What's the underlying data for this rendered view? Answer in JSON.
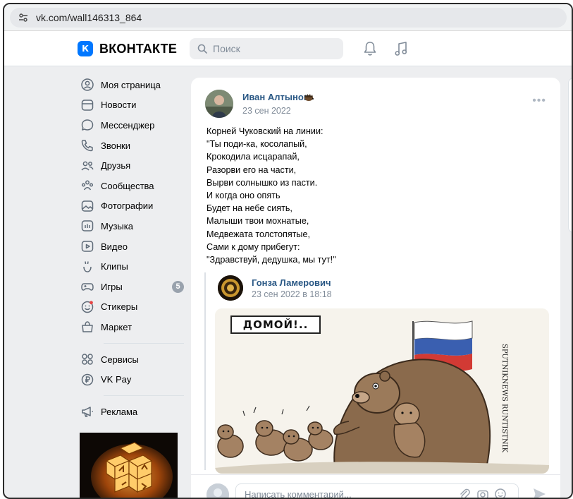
{
  "browser": {
    "url": "vk.com/wall146313_864"
  },
  "header": {
    "logo_text": "ВКОНТАКТЕ",
    "logo_badge": "К",
    "search_placeholder": "Поиск"
  },
  "sidebar": {
    "items": [
      {
        "label": "Моя страница",
        "icon": "user-circle-icon"
      },
      {
        "label": "Новости",
        "icon": "newspaper-icon"
      },
      {
        "label": "Мессенджер",
        "icon": "message-bubble-icon"
      },
      {
        "label": "Звонки",
        "icon": "phone-icon"
      },
      {
        "label": "Друзья",
        "icon": "friends-icon"
      },
      {
        "label": "Сообщества",
        "icon": "communities-icon"
      },
      {
        "label": "Фотографии",
        "icon": "photo-icon"
      },
      {
        "label": "Музыка",
        "icon": "music-icon"
      },
      {
        "label": "Видео",
        "icon": "video-icon"
      },
      {
        "label": "Клипы",
        "icon": "clips-icon"
      },
      {
        "label": "Игры",
        "icon": "gamepad-icon",
        "badge": "5"
      },
      {
        "label": "Стикеры",
        "icon": "sticker-icon"
      },
      {
        "label": "Маркет",
        "icon": "shopping-bag-icon"
      }
    ],
    "extra": [
      {
        "label": "Сервисы",
        "icon": "services-grid-icon"
      },
      {
        "label": "VK Pay",
        "icon": "ruble-coin-icon"
      }
    ],
    "ads": {
      "label": "Реклама",
      "icon": "megaphone-icon"
    }
  },
  "post": {
    "author": "Иван Алтынов",
    "date": "23 сен 2022",
    "more": "•••",
    "text_lines": [
      "Корней Чуковский на линии:",
      "\"Ты поди-ка, косолапый,",
      "Крокодила исцарапай,",
      "Разорви его на части,",
      "Вырви солнышко из пасти.",
      "И когда оно опять",
      "Будет на небе сиять,",
      "Малыши твои мохнатые,",
      "Медвежата толстопятые,",
      "Сами к дому прибегут:",
      "\"Здравствуй, дедушка, мы тут!\""
    ],
    "repost": {
      "author": "Гонза Ламерович",
      "date": "23 сен 2022 в 18:18",
      "cartoon_sign": "ДОМОЙ!..",
      "cartoon_signature": "SPUTNIKNEWS RUNTISTNIK"
    }
  },
  "comment": {
    "placeholder": "Написать комментарий..."
  },
  "colors": {
    "vk_blue": "#0077ff",
    "link": "#2a5885",
    "muted": "#818c99",
    "page_bg": "#edeef0"
  }
}
